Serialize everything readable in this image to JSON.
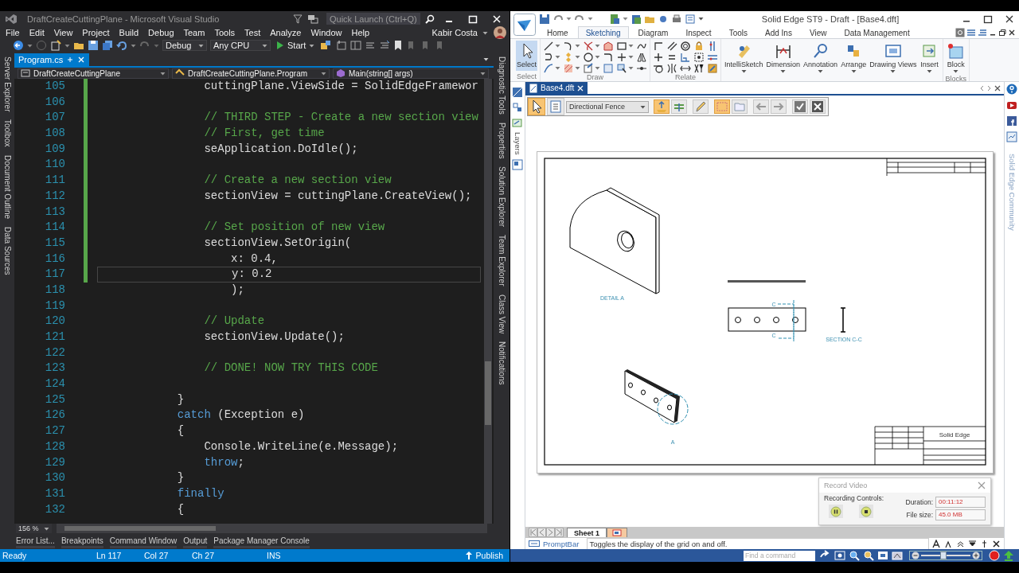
{
  "vs": {
    "title": "DraftCreateCuttingPlane - Microsoft Visual Studio",
    "quick_launch": {
      "placeholder": "Quick Launch (Ctrl+Q)"
    },
    "menu": [
      "File",
      "Edit",
      "View",
      "Project",
      "Build",
      "Debug",
      "Team",
      "Tools",
      "Test",
      "Analyze",
      "Window",
      "Help"
    ],
    "user": "Kabir Costa",
    "toolbar": {
      "configuration": "Debug",
      "platform": "Any CPU",
      "start": "Start"
    },
    "left_panels": [
      "Server Explorer",
      "Toolbox",
      "Document Outline",
      "Data Sources"
    ],
    "right_panels": [
      "Diagnostic Tools",
      "Properties",
      "Solution Explorer",
      "Team Explorer",
      "Class View",
      "Notifications"
    ],
    "tabs": [
      {
        "label": "Program.cs",
        "selected": true
      }
    ],
    "nav": [
      "DraftCreateCuttingPlane",
      "DraftCreateCuttingPlane.Program",
      "Main(string[] args)"
    ],
    "code": [
      {
        "number": "105",
        "changed": true,
        "current": false,
        "tokens": [
          {
            "kind": "plain",
            "text": "                cuttingPlane.ViewSide = SolidEdgeFramewor"
          }
        ]
      },
      {
        "number": "106",
        "changed": true,
        "current": false
      },
      {
        "number": "107",
        "changed": true,
        "current": false,
        "tokens": [
          {
            "kind": "comment",
            "text": "                // THIRD STEP - Create a new section view"
          }
        ]
      },
      {
        "number": "108",
        "changed": true,
        "current": false,
        "tokens": [
          {
            "kind": "comment",
            "text": "                // First, get time"
          }
        ]
      },
      {
        "number": "109",
        "changed": true,
        "current": false,
        "tokens": [
          {
            "kind": "plain",
            "text": "                seApplication.DoIdle();"
          }
        ]
      },
      {
        "number": "110",
        "changed": true,
        "current": false
      },
      {
        "number": "111",
        "changed": true,
        "current": false,
        "tokens": [
          {
            "kind": "comment",
            "text": "                // Create a new section view"
          }
        ]
      },
      {
        "number": "112",
        "changed": true,
        "current": false,
        "tokens": [
          {
            "kind": "plain",
            "text": "                sectionView = cuttingPlane.CreateView();"
          }
        ]
      },
      {
        "number": "113",
        "changed": true,
        "current": false
      },
      {
        "number": "114",
        "changed": true,
        "current": false,
        "tokens": [
          {
            "kind": "comment",
            "text": "                // Set position of new view"
          }
        ]
      },
      {
        "number": "115",
        "changed": true,
        "current": false,
        "tokens": [
          {
            "kind": "plain",
            "text": "                sectionView.SetOrigin("
          }
        ]
      },
      {
        "number": "116",
        "changed": true,
        "current": false,
        "tokens": [
          {
            "kind": "plain",
            "text": "                    x: 0.4,"
          }
        ]
      },
      {
        "number": "117",
        "changed": true,
        "current": true,
        "tokens": [
          {
            "kind": "plain",
            "text": "                    y: 0.2"
          }
        ]
      },
      {
        "number": "118",
        "changed": false,
        "current": false,
        "tokens": [
          {
            "kind": "plain",
            "text": "                    );"
          }
        ]
      },
      {
        "number": "119",
        "changed": false,
        "current": false
      },
      {
        "number": "120",
        "changed": false,
        "current": false,
        "tokens": [
          {
            "kind": "comment",
            "text": "                // Update"
          }
        ]
      },
      {
        "number": "121",
        "changed": false,
        "current": false,
        "tokens": [
          {
            "kind": "plain",
            "text": "                sectionView.Update();"
          }
        ]
      },
      {
        "number": "122",
        "changed": false,
        "current": false
      },
      {
        "number": "123",
        "changed": false,
        "current": false,
        "tokens": [
          {
            "kind": "comment",
            "text": "                // DONE! NOW TRY THIS CODE"
          }
        ]
      },
      {
        "number": "124",
        "changed": false,
        "current": false
      },
      {
        "number": "125",
        "changed": false,
        "current": false,
        "tokens": [
          {
            "kind": "plain",
            "text": "            }"
          }
        ]
      },
      {
        "number": "126",
        "changed": false,
        "current": false,
        "tokens": [
          {
            "kind": "keyword",
            "text": "            catch"
          },
          {
            "kind": "plain",
            "text": " (Exception e)"
          }
        ]
      },
      {
        "number": "127",
        "changed": false,
        "current": false,
        "tokens": [
          {
            "kind": "plain",
            "text": "            {"
          }
        ]
      },
      {
        "number": "128",
        "changed": false,
        "current": false,
        "tokens": [
          {
            "kind": "plain",
            "text": "                Console.WriteLine(e.Message);"
          }
        ]
      },
      {
        "number": "129",
        "changed": false,
        "current": false,
        "tokens": [
          {
            "kind": "keyword",
            "text": "                throw"
          },
          {
            "kind": "plain",
            "text": ";"
          }
        ]
      },
      {
        "number": "130",
        "changed": false,
        "current": false,
        "tokens": [
          {
            "kind": "plain",
            "text": "            }"
          }
        ]
      },
      {
        "number": "131",
        "changed": false,
        "current": false,
        "tokens": [
          {
            "kind": "keyword",
            "text": "            finally"
          }
        ]
      },
      {
        "number": "132",
        "changed": false,
        "current": false,
        "tokens": [
          {
            "kind": "plain",
            "text": "            {"
          }
        ]
      }
    ],
    "zoom": "156 %",
    "tool_tabs": [
      "Error List...",
      "Breakpoints",
      "Command Window",
      "Output",
      "Package Manager Console"
    ],
    "status": {
      "state": "Ready",
      "line": "Ln 117",
      "column": "Col 27",
      "char": "Ch 27",
      "mode": "INS",
      "publish": "Publish"
    }
  },
  "se": {
    "title": "Solid Edge ST9 - Draft - [Base4.dft]",
    "tabs": [
      {
        "label": "Home",
        "selected": false
      },
      {
        "label": "Sketching",
        "selected": true
      },
      {
        "label": "Diagram",
        "selected": false
      },
      {
        "label": "Inspect",
        "selected": false
      },
      {
        "label": "Tools",
        "selected": false
      },
      {
        "label": "Add Ins",
        "selected": false
      },
      {
        "label": "View",
        "selected": false
      },
      {
        "label": "Data Management",
        "selected": false
      }
    ],
    "ribbon": [
      {
        "kind": "large",
        "label": "Select",
        "buttons": [
          {
            "label": "Select",
            "selected": true,
            "menu": false
          }
        ]
      },
      {
        "kind": "tools",
        "label": "Draw"
      },
      {
        "kind": "tools",
        "label": "Relate"
      },
      {
        "kind": "large",
        "buttons": [
          {
            "label": "IntelliSketch",
            "selected": false,
            "menu": true
          },
          {
            "label": "Dimension",
            "selected": false,
            "menu": true
          },
          {
            "label": "Annotation",
            "selected": false,
            "menu": true
          },
          {
            "label": "Arrange",
            "selected": false,
            "menu": true
          },
          {
            "label": "Drawing Views",
            "selected": false,
            "menu": true
          },
          {
            "label": "Insert",
            "selected": false,
            "menu": true
          }
        ]
      },
      {
        "kind": "large",
        "label": "Blocks",
        "buttons": [
          {
            "label": "Block",
            "selected": false,
            "menu": true
          }
        ]
      }
    ],
    "left_panels": [
      "Layers"
    ],
    "right_panels": [
      "Solid Edge Community"
    ],
    "doc_tabs": [
      {
        "label": "Base4.dft",
        "selected": true
      }
    ],
    "command_bar": {
      "selection": "Directional Fence"
    },
    "drawing": {
      "detail_label": "DETAIL A",
      "section_label": "SECTION C-C",
      "detail_callout": "A",
      "cutting_plane_labels": [
        "C",
        "C"
      ],
      "title_block_name": "Solid Edge"
    },
    "record_video": {
      "title": "Record Video",
      "controls_label": "Recording Controls:",
      "duration_label": "Duration:",
      "duration": "00:11:12",
      "file_size_label": "File size:",
      "file_size": "45.0 MB"
    },
    "sheets": [
      {
        "label": "Sheet 1",
        "selected": true
      }
    ],
    "prompt_bar": {
      "label": "PromptBar",
      "message": "Toggles the display of the grid on and off."
    },
    "status": {
      "find": {
        "placeholder": "Find a command"
      },
      "zoom": {
        "level": 0.45
      }
    }
  }
}
